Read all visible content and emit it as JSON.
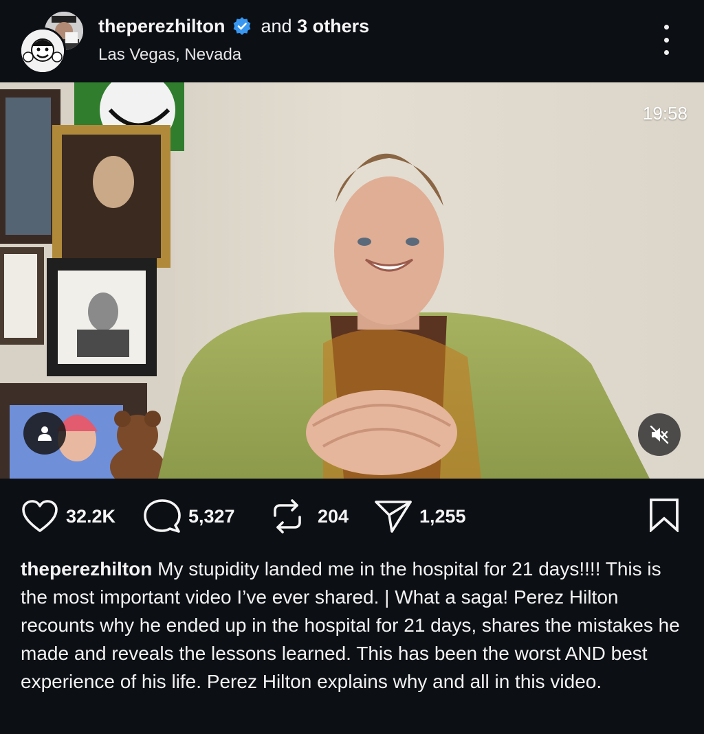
{
  "header": {
    "username": "theperezhilton",
    "verified_icon": "verified-badge-icon",
    "verified_color": "#3897f0",
    "and_text": "and",
    "others_count": "3 others",
    "location": "Las Vegas, Nevada",
    "more_icon": "more-vertical-icon"
  },
  "video": {
    "timestamp": "19:58",
    "tag_icon": "person-tag-icon",
    "mute_icon": "speaker-muted-icon"
  },
  "actions": {
    "likes": "32.2K",
    "comments": "5,327",
    "reposts": "204",
    "shares": "1,255",
    "like_icon": "heart-icon",
    "comment_icon": "comment-bubble-icon",
    "repost_icon": "repost-icon",
    "share_icon": "send-icon",
    "bookmark_icon": "bookmark-icon"
  },
  "caption": {
    "username": "theperezhilton",
    "text": "My stupidity landed me in the hospital for 21 days!!!! This is the most important video I’ve ever shared. | What a saga! Perez Hilton recounts why he ended up in the hospital for 21 days, shares the mistakes he made and reveals the lessons learned. This has been the worst AND best experience of his life. Perez Hilton explains why and all in this video."
  },
  "colors": {
    "background": "#0c0f14",
    "text": "#f5f5f5"
  }
}
